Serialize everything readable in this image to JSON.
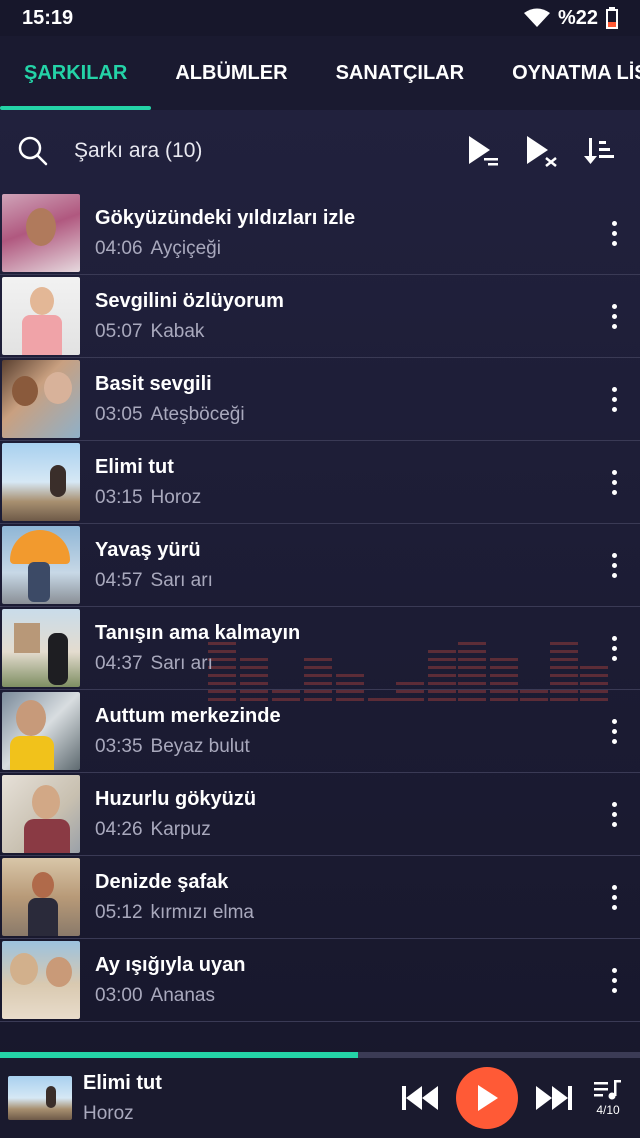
{
  "status": {
    "time": "15:19",
    "battery": "%22"
  },
  "tabs": [
    {
      "label": "ŞARKILAR"
    },
    {
      "label": "ALBÜMLER"
    },
    {
      "label": "SANATÇILAR"
    },
    {
      "label": "OYNATMA LİSTE"
    }
  ],
  "search": {
    "placeholder": "Şarkı ara (10)"
  },
  "songs": [
    {
      "title": "Gökyüzündeki yıldızları izle",
      "duration": "04:06",
      "artist": "Ayçiçeği"
    },
    {
      "title": "Sevgilini özlüyorum",
      "duration": "05:07",
      "artist": "Kabak"
    },
    {
      "title": "Basit sevgili",
      "duration": "03:05",
      "artist": "Ateşböceği"
    },
    {
      "title": "Elimi tut",
      "duration": "03:15",
      "artist": "Horoz"
    },
    {
      "title": "Yavaş yürü",
      "duration": "04:57",
      "artist": "Sarı arı"
    },
    {
      "title": "Tanışın ama kalmayın",
      "duration": "04:37",
      "artist": "Sarı arı"
    },
    {
      "title": "Auttum merkezinde",
      "duration": "03:35",
      "artist": "Beyaz bulut"
    },
    {
      "title": "Huzurlu gökyüzü",
      "duration": "04:26",
      "artist": "Karpuz"
    },
    {
      "title": "Denizde şafak",
      "duration": "05:12",
      "artist": "kırmızı elma"
    },
    {
      "title": "Ay ışığıyla uyan",
      "duration": "03:00",
      "artist": "Ananas"
    }
  ],
  "now_playing": {
    "title": "Elimi tut",
    "artist": "Horoz",
    "queue": "4/10",
    "progress": 0.56
  },
  "colors": {
    "accent": "#24d3a7",
    "play": "#ff5a36",
    "background": "#1e1e37"
  }
}
